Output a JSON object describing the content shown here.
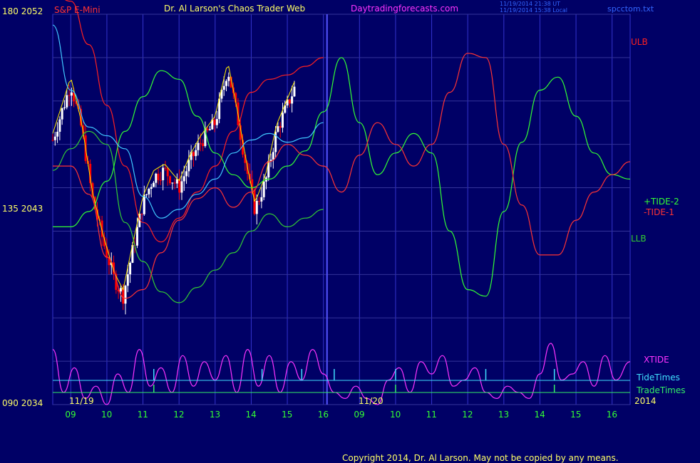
{
  "header": {
    "instrument": "S&P E-Mini",
    "site_title": "Dr. Al Larson's Chaos Trader Web",
    "site_url": "Daytradingforecasts.com",
    "timestamp_utc": "11/19/2014 21:38 UT",
    "timestamp_local": "11/19/2014 15:38 Local",
    "file_name": "spcctom.txt"
  },
  "y_axis": {
    "top_label": "180  2052",
    "mid_label": "135  2043",
    "bottom_label": "090  2034"
  },
  "x_axis": {
    "hour_ticks": [
      "09",
      "10",
      "11",
      "12",
      "13",
      "14",
      "15",
      "16",
      "09",
      "10",
      "11",
      "12",
      "13",
      "14",
      "15",
      "16"
    ],
    "date_labels": [
      "11/19",
      "11/20"
    ],
    "year_label": "2014"
  },
  "legend": {
    "ulb": "ULB",
    "tide2": "+TIDE-2",
    "tide1": "-TIDE-1",
    "llb": "LLB",
    "xtide": "XTIDE",
    "tide_times": "TideTimes",
    "trade_times": "TradeTimes"
  },
  "footer": {
    "copyright": "Copyright 2014, Dr. Al Larson. May not be copied by any means."
  },
  "colors": {
    "background": "#000066",
    "grid": "#3333cc",
    "ulb": "#ff2020",
    "llb": "#33cc33",
    "tide2": "#33ff33",
    "tide1": "#ff3333",
    "cyan_line": "#40c8ff",
    "xtide": "#ff33ff",
    "tide_times": "#40e0ff",
    "trade_times": "#33ee66",
    "bull_bar": "#ffffff",
    "bear_bar": "#ff0000",
    "ma_line": "#ffee00",
    "axis_text": "#ffff66",
    "hour_text": "#33ff33"
  },
  "chart_data": {
    "type": "line",
    "title": "S&P E-Mini",
    "x_range": [
      8.5,
      16.5
    ],
    "y_range": [
      2034,
      2052
    ],
    "series": [
      {
        "name": "ULB",
        "x": [
          8.5,
          9.0,
          9.5,
          10.0,
          10.5,
          11.0,
          11.5,
          12.0,
          12.5,
          13.0,
          13.5,
          14.0,
          14.5,
          15.0,
          15.5,
          16.0
        ],
        "values": [
          2053.0,
          2052.6,
          2050.6,
          2047.8,
          2045.0,
          2042.4,
          2041.5,
          2042.6,
          2043.8,
          2045.0,
          2046.6,
          2048.4,
          2049.0,
          2049.2,
          2049.6,
          2050.0
        ]
      },
      {
        "name": "LLB",
        "x": [
          8.5,
          9.0,
          9.5,
          10.0,
          10.5,
          11.0,
          11.5,
          12.0,
          12.5,
          13.0,
          13.5,
          14.0,
          14.5,
          15.0,
          15.5,
          16.0
        ],
        "values": [
          2044.8,
          2045.8,
          2046.6,
          2046.0,
          2042.4,
          2040.6,
          2039.2,
          2038.7,
          2039.4,
          2040.2,
          2041.0,
          2042.0,
          2042.8,
          2042.2,
          2042.6,
          2043.0
        ]
      },
      {
        "name": "+TIDE-2",
        "x": [
          8.5,
          9.0,
          9.5,
          10.0,
          10.5,
          11.0,
          11.5,
          12.0,
          12.5,
          13.0,
          13.5,
          14.0,
          14.5,
          15.0,
          15.5,
          16.0,
          16.5,
          17.0,
          17.5,
          18.0,
          18.5,
          19.0,
          19.5,
          20.0,
          20.5,
          21.0,
          21.5,
          22.0,
          22.5,
          23.0,
          23.5,
          24.0,
          24.5
        ],
        "values": [
          2042.2,
          2042.2,
          2042.9,
          2044.3,
          2046.6,
          2048.2,
          2049.4,
          2049.0,
          2047.3,
          2045.6,
          2044.6,
          2044.0,
          2044.4,
          2045.0,
          2045.7,
          2047.5,
          2050.0,
          2047.0,
          2044.6,
          2045.6,
          2046.5,
          2045.6,
          2042.0,
          2039.3,
          2039.0,
          2042.9,
          2046.1,
          2048.5,
          2049.1,
          2047.3,
          2045.6,
          2044.6,
          2044.4
        ]
      },
      {
        "name": "-TIDE-1",
        "x": [
          8.5,
          9.0,
          9.5,
          10.0,
          10.5,
          11.0,
          11.5,
          12.0,
          12.5,
          13.0,
          13.5,
          14.0,
          14.5,
          15.0,
          15.5,
          16.0,
          16.5,
          17.0,
          17.5,
          18.0,
          18.5,
          19.0,
          19.5,
          20.0,
          20.5,
          21.0,
          21.5,
          22.0,
          22.5,
          23.0,
          23.5,
          24.0,
          24.5
        ],
        "values": [
          2045.0,
          2045.0,
          2043.7,
          2040.8,
          2038.9,
          2039.3,
          2041.0,
          2042.5,
          2043.5,
          2044.0,
          2043.1,
          2043.8,
          2045.2,
          2046.0,
          2045.5,
          2045.0,
          2043.8,
          2045.5,
          2047.0,
          2046.0,
          2045.0,
          2046.0,
          2048.4,
          2050.2,
          2050.0,
          2046.0,
          2043.2,
          2040.9,
          2040.9,
          2042.5,
          2043.8,
          2044.6,
          2045.2
        ]
      },
      {
        "name": "Cyan Line",
        "x": [
          8.5,
          9.0,
          9.5,
          10.0,
          10.5,
          11.0,
          11.5,
          12.0,
          12.5,
          13.0,
          13.5,
          14.0,
          14.5,
          15.0,
          15.5,
          16.0
        ],
        "values": [
          2051.5,
          2048.5,
          2046.8,
          2046.4,
          2045.8,
          2043.6,
          2042.6,
          2043.0,
          2043.7,
          2044.4,
          2045.6,
          2046.2,
          2046.5,
          2046.1,
          2046.3,
          2047.0
        ]
      },
      {
        "name": "XTIDE",
        "x": [
          8.5,
          8.8,
          9.1,
          9.4,
          9.7,
          10.0,
          10.3,
          10.6,
          10.9,
          11.2,
          11.5,
          11.8,
          12.1,
          12.4,
          12.7,
          13.0,
          13.3,
          13.6,
          13.9,
          14.2,
          14.5,
          14.8,
          15.1,
          15.4,
          15.7,
          16.0,
          16.3,
          16.6,
          16.9,
          17.2,
          17.5,
          17.8,
          18.1,
          18.4,
          18.7,
          19.0,
          19.3,
          19.6,
          19.9,
          20.2,
          20.5,
          20.8,
          21.1,
          21.4,
          21.7,
          22.0,
          22.3,
          22.6,
          22.9,
          23.2,
          23.5,
          23.8,
          24.1,
          24.5
        ],
        "values": [
          0.9,
          0.2,
          0.6,
          0.1,
          0.3,
          0.0,
          0.5,
          0.2,
          0.9,
          0.3,
          0.6,
          0.2,
          0.8,
          0.3,
          0.7,
          0.4,
          0.8,
          0.2,
          0.9,
          0.3,
          0.8,
          0.2,
          0.7,
          0.4,
          0.9,
          0.5,
          0.2,
          0.1,
          0.3,
          0.1,
          0.0,
          0.4,
          0.6,
          0.2,
          0.7,
          0.5,
          0.8,
          0.3,
          0.4,
          0.6,
          0.2,
          0.1,
          0.3,
          0.2,
          0.1,
          0.5,
          1.0,
          0.4,
          0.5,
          0.7,
          0.3,
          0.8,
          0.4,
          0.7
        ]
      }
    ]
  }
}
